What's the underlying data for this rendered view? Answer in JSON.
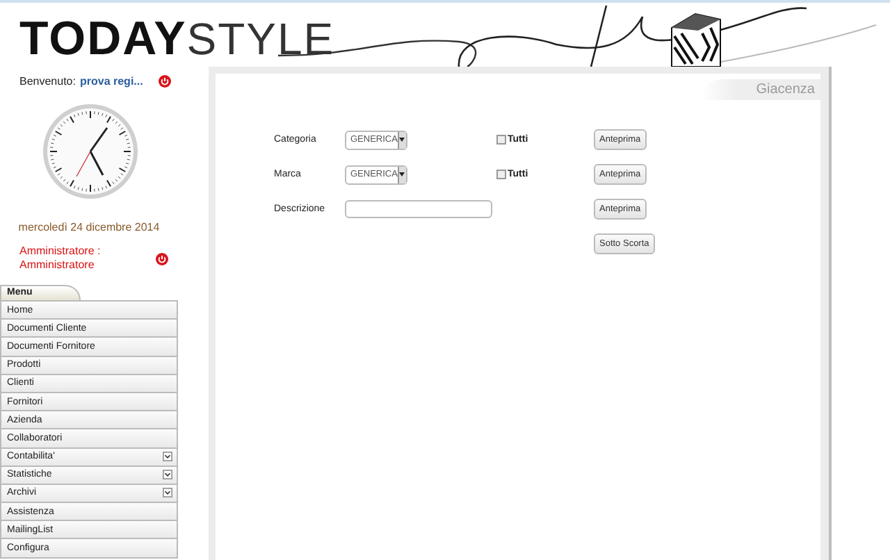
{
  "header": {
    "logo": {
      "accent": "TODAY",
      "light": "STYLE"
    }
  },
  "welcome": {
    "label": "Benvenuto:",
    "user": "prova regi..."
  },
  "date": "mercoledì 24 dicembre 2014",
  "role": "Amministratore : Amministratore",
  "menu": {
    "title": "Menu",
    "items": [
      {
        "label": "Home",
        "kind": "link"
      },
      {
        "label": "Documenti Cliente",
        "kind": "link"
      },
      {
        "label": "Documenti Fornitore",
        "kind": "link"
      },
      {
        "label": "Prodotti",
        "kind": "link"
      },
      {
        "label": "Clienti",
        "kind": "link"
      },
      {
        "label": "Fornitori",
        "kind": "link"
      },
      {
        "label": "Azienda",
        "kind": "link"
      },
      {
        "label": "Collaboratori",
        "kind": "link"
      },
      {
        "label": "Contabilita'",
        "kind": "submenu"
      },
      {
        "label": "Statistiche",
        "kind": "submenu"
      },
      {
        "label": "Archivi",
        "kind": "submenu"
      },
      {
        "label": "Assistenza",
        "kind": "link"
      },
      {
        "label": "MailingList",
        "kind": "link"
      },
      {
        "label": "Configura",
        "kind": "link"
      }
    ]
  },
  "panel": {
    "title": "Giacenza",
    "rows": [
      {
        "kind": "select",
        "label": "Categoria",
        "value": "GENERICA",
        "checkbox": {
          "label": "Tutti",
          "checked": false
        },
        "button": "Anteprima"
      },
      {
        "kind": "select",
        "label": "Marca",
        "value": "GENERICA",
        "checkbox": {
          "label": "Tutti",
          "checked": false
        },
        "button": "Anteprima"
      },
      {
        "kind": "text",
        "label": "Descrizione",
        "value": "",
        "button": "Anteprima"
      },
      {
        "kind": "button",
        "button": "Sotto Scorta"
      }
    ]
  }
}
